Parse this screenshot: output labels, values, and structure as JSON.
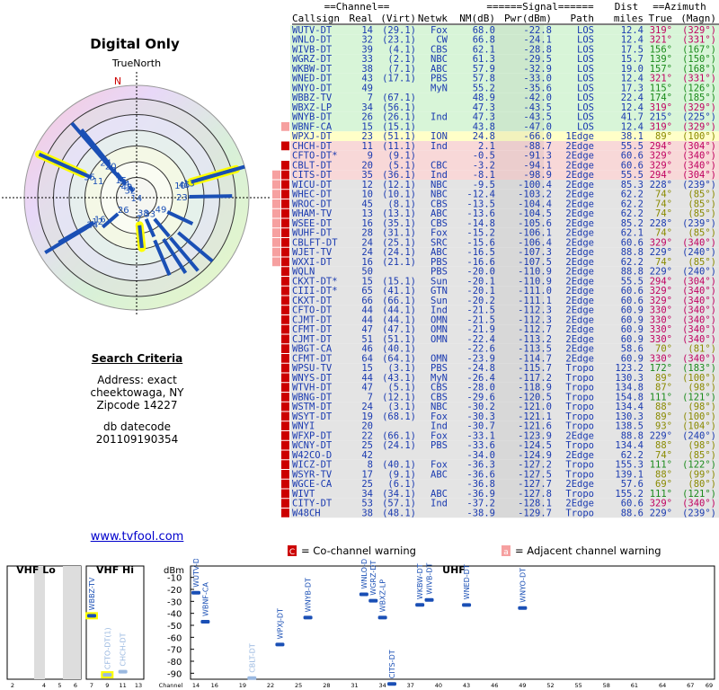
{
  "title": "Digital Only",
  "polar": {
    "north_label": "TrueNorth",
    "n_letter": "N",
    "stations": [
      {
        "label": "24",
        "az": 319,
        "len": 0.88,
        "color": "#1a4fb5",
        "hl": false
      },
      {
        "label": "20",
        "az": 321,
        "len": 0.78,
        "color": "#1a4fb5",
        "hl": false
      },
      {
        "label": "9",
        "az": 321,
        "len": 0.7,
        "color": "#1a4fb5",
        "hl": false
      },
      {
        "label": "15",
        "az": 319,
        "len": 0.5,
        "color": "#1a4fb5",
        "hl": false
      },
      {
        "label": "34",
        "az": 319,
        "len": 0.42,
        "color": "#1a4fb5",
        "hl": false
      },
      {
        "label": "43",
        "az": 319,
        "len": 0.36,
        "color": "#1a4fb5",
        "hl": false
      },
      {
        "label": "32",
        "az": 321,
        "len": 0.28,
        "color": "#1a4fb5",
        "hl": false
      },
      {
        "label": "14",
        "az": 329,
        "len": 0.12,
        "color": "#1a4fb5",
        "hl": false
      },
      {
        "label": "35",
        "az": 294,
        "len": 0.95,
        "color": "#1a4fb5",
        "hl": true
      },
      {
        "label": "11",
        "az": 294,
        "len": 0.8,
        "color": "#1a4fb5",
        "hl": false
      },
      {
        "label": "10",
        "az": 74,
        "len": 0.85,
        "color": "#1a4fb5",
        "hl": false
      },
      {
        "label": "45",
        "az": 74,
        "len": 0.92,
        "color": "#1a4fb5",
        "hl": true
      },
      {
        "label": "13",
        "az": 74,
        "len": 1.0,
        "color": "#1a4fb5",
        "hl": false
      },
      {
        "label": "23",
        "az": 89,
        "len": 0.85,
        "color": "#1a4fb5",
        "hl": false
      },
      {
        "label": "49",
        "az": 115,
        "len": 0.55,
        "color": "#1a4fb5",
        "hl": false
      },
      {
        "label": "33",
        "az": 140,
        "len": 0.45,
        "color": "#1a4fb5",
        "hl": false
      },
      {
        "label": "7",
        "az": 174,
        "len": 0.45,
        "color": "#1a4fb5",
        "hl": true
      },
      {
        "label": "38",
        "az": 156,
        "len": 0.38,
        "color": "#1a4fb5",
        "hl": false
      },
      {
        "label": "26",
        "az": 229,
        "len": 0.4,
        "color": "#1a4fb5",
        "hl": false
      },
      {
        "label": "16",
        "az": 240,
        "len": 0.8,
        "color": "#1a4fb5",
        "hl": false
      },
      {
        "label": "12",
        "az": 239,
        "len": 0.85,
        "color": "#1a4fb5",
        "hl": false
      },
      {
        "label": "24",
        "az": 239,
        "len": 0.95,
        "color": "#1a4fb5",
        "hl": false
      },
      {
        "label": "",
        "az": 147,
        "len": 0.8,
        "color": "#1a4fb5",
        "hl": false
      },
      {
        "label": "",
        "az": 140,
        "len": 0.85,
        "color": "#1a4fb5",
        "hl": false
      },
      {
        "label": "",
        "az": 130,
        "len": 0.88,
        "color": "#1a4fb5",
        "hl": false
      },
      {
        "label": "",
        "az": 157,
        "len": 0.75,
        "color": "#1a4fb5",
        "hl": false
      }
    ]
  },
  "criteria": {
    "heading": "Search Criteria",
    "address": "Address: exact",
    "city": "cheektowaga, NY",
    "zip": "Zipcode 14227",
    "db_label": "db datecode",
    "db_code": "201109190354"
  },
  "site_link": "www.tvfool.com",
  "table": {
    "group_headers": {
      "channel": "Channel",
      "signal": "Signal",
      "dist": "Dist",
      "azimuth": "Azimuth"
    },
    "col_headers": [
      "Callsign",
      "Real",
      "(Virt)",
      "Netwk",
      "NM(dB)",
      "Pwr(dBm)",
      "Path",
      "miles",
      "True",
      "(Magn)"
    ],
    "rows": [
      [
        "WUTV-DT",
        "14",
        "(29.1)",
        "Fox",
        "68.0",
        "-22.8",
        "LOS",
        "12.4",
        "319°",
        "(329°)",
        "g",
        ""
      ],
      [
        "WNLO-DT",
        "32",
        "(23.1)",
        "CW",
        "66.8",
        "-24.1",
        "LOS",
        "12.4",
        "321°",
        "(331°)",
        "g",
        ""
      ],
      [
        "WIVB-DT",
        "39",
        "(4.1)",
        "CBS",
        "62.1",
        "-28.8",
        "LOS",
        "17.5",
        "156°",
        "(167°)",
        "g",
        ""
      ],
      [
        "WGRZ-DT",
        "33",
        "(2.1)",
        "NBC",
        "61.3",
        "-29.5",
        "LOS",
        "15.7",
        "139°",
        "(150°)",
        "g",
        ""
      ],
      [
        "WKBW-DT",
        "38",
        "(7.1)",
        "ABC",
        "57.9",
        "-32.9",
        "LOS",
        "19.0",
        "157°",
        "(168°)",
        "g",
        ""
      ],
      [
        "WNED-DT",
        "43",
        "(17.1)",
        "PBS",
        "57.8",
        "-33.0",
        "LOS",
        "12.4",
        "321°",
        "(331°)",
        "g",
        ""
      ],
      [
        "WNYO-DT",
        "49",
        "",
        "MyN",
        "55.2",
        "-35.6",
        "LOS",
        "17.3",
        "115°",
        "(126°)",
        "g",
        ""
      ],
      [
        "WBBZ-TV",
        "7",
        "(67.1)",
        "",
        "48.9",
        "-42.0",
        "LOS",
        "22.4",
        "174°",
        "(185°)",
        "b",
        ""
      ],
      [
        "WBXZ-LP",
        "34",
        "(56.1)",
        "",
        "47.3",
        "-43.5",
        "LOS",
        "12.4",
        "319°",
        "(329°)",
        "b",
        ""
      ],
      [
        "WNYB-DT",
        "26",
        "(26.1)",
        "Ind",
        "47.3",
        "-43.5",
        "LOS",
        "41.7",
        "215°",
        "(225°)",
        "b",
        ""
      ],
      [
        "WBNF-CA",
        "15",
        "(15.1)",
        "",
        "43.8",
        "-47.0",
        "LOS",
        "12.4",
        "319°",
        "(329°)",
        "b",
        "a"
      ],
      [
        "WPXJ-DT",
        "23",
        "(51.1)",
        "ION",
        "24.8",
        "-66.0",
        "1Edge",
        "38.1",
        "89°",
        "(100°)",
        "y",
        ""
      ],
      [
        "CHCH-DT",
        "11",
        "(11.1)",
        "Ind",
        "2.1",
        "-88.7",
        "2Edge",
        "55.5",
        "294°",
        "(304°)",
        "p",
        "c"
      ],
      [
        "CFTO-DT*",
        "9",
        "(9.1)",
        "",
        "-0.5",
        "-91.3",
        "2Edge",
        "60.6",
        "329°",
        "(340°)",
        "p",
        ""
      ],
      [
        "CBLT-DT",
        "20",
        "(5.1)",
        "CBC",
        "-3.2",
        "-94.1",
        "2Edge",
        "60.6",
        "329°",
        "(340°)",
        "p",
        "c"
      ],
      [
        "CITS-DT",
        "35",
        "(36.1)",
        "Ind",
        "-8.1",
        "-98.9",
        "2Edge",
        "55.5",
        "294°",
        "(304°)",
        "p",
        "ca"
      ],
      [
        "WICU-DT",
        "12",
        "(12.1)",
        "NBC",
        "-9.5",
        "-100.4",
        "2Edge",
        "85.3",
        "228°",
        "(239°)",
        "w",
        "ca"
      ],
      [
        "WHEC-DT",
        "10",
        "(10.1)",
        "NBC",
        "-12.4",
        "-103.2",
        "2Edge",
        "62.2",
        "74°",
        "(85°)",
        "w",
        "ca"
      ],
      [
        "WROC-DT",
        "45",
        "(8.1)",
        "CBS",
        "-13.5",
        "-104.4",
        "2Edge",
        "62.2",
        "74°",
        "(85°)",
        "w",
        "ca"
      ],
      [
        "WHAM-TV",
        "13",
        "(13.1)",
        "ABC",
        "-13.6",
        "-104.5",
        "2Edge",
        "62.2",
        "74°",
        "(85°)",
        "w",
        "ca"
      ],
      [
        "WSEE-DT",
        "16",
        "(35.1)",
        "CBS",
        "-14.8",
        "-105.6",
        "2Edge",
        "85.2",
        "228°",
        "(239°)",
        "w",
        "ca"
      ],
      [
        "WUHF-DT",
        "28",
        "(31.1)",
        "Fox",
        "-15.2",
        "-106.1",
        "2Edge",
        "62.1",
        "74°",
        "(85°)",
        "w",
        "ca"
      ],
      [
        "CBLFT-DT",
        "24",
        "(25.1)",
        "SRC",
        "-15.6",
        "-106.4",
        "2Edge",
        "60.6",
        "329°",
        "(340°)",
        "w",
        "ca"
      ],
      [
        "WJET-TV",
        "24",
        "(24.1)",
        "ABC",
        "-16.5",
        "-107.3",
        "2Edge",
        "88.8",
        "229°",
        "(240°)",
        "w",
        "ca"
      ],
      [
        "WXXI-DT",
        "16",
        "(21.1)",
        "PBS",
        "-16.6",
        "-107.5",
        "2Edge",
        "62.2",
        "74°",
        "(85°)",
        "w",
        "ca"
      ],
      [
        "WQLN",
        "50",
        "",
        "PBS",
        "-20.0",
        "-110.9",
        "2Edge",
        "88.8",
        "229°",
        "(240°)",
        "w",
        "c"
      ],
      [
        "CKXT-DT*",
        "15",
        "(15.1)",
        "Sun",
        "-20.1",
        "-110.9",
        "2Edge",
        "55.5",
        "294°",
        "(304°)",
        "w",
        "c"
      ],
      [
        "CIII-DT*",
        "65",
        "(41.1)",
        "GTN",
        "-20.1",
        "-111.0",
        "2Edge",
        "60.6",
        "329°",
        "(340°)",
        "w",
        "c"
      ],
      [
        "CKXT-DT",
        "66",
        "(66.1)",
        "Sun",
        "-20.2",
        "-111.1",
        "2Edge",
        "60.6",
        "329°",
        "(340°)",
        "w",
        "c"
      ],
      [
        "CFTO-DT",
        "44",
        "(44.1)",
        "Ind",
        "-21.5",
        "-112.3",
        "2Edge",
        "60.9",
        "330°",
        "(340°)",
        "w",
        "c"
      ],
      [
        "CJMT-DT",
        "44",
        "(44.1)",
        "OMN",
        "-21.5",
        "-112.3",
        "2Edge",
        "60.9",
        "330°",
        "(340°)",
        "w",
        "c"
      ],
      [
        "CFMT-DT",
        "47",
        "(47.1)",
        "OMN",
        "-21.9",
        "-112.7",
        "2Edge",
        "60.9",
        "330°",
        "(340°)",
        "w",
        "c"
      ],
      [
        "CJMT-DT",
        "51",
        "(51.1)",
        "OMN",
        "-22.4",
        "-113.2",
        "2Edge",
        "60.9",
        "330°",
        "(340°)",
        "w",
        "c"
      ],
      [
        "WBGT-CA",
        "46",
        "(40.1)",
        "",
        "-22.6",
        "-113.5",
        "2Edge",
        "58.6",
        "70°",
        "(81°)",
        "w",
        "c"
      ],
      [
        "CFMT-DT",
        "64",
        "(64.1)",
        "OMN",
        "-23.9",
        "-114.7",
        "2Edge",
        "60.9",
        "330°",
        "(340°)",
        "w",
        "c"
      ],
      [
        "WPSU-TV",
        "15",
        "(3.1)",
        "PBS",
        "-24.8",
        "-115.7",
        "Tropo",
        "123.2",
        "172°",
        "(183°)",
        "w",
        "c"
      ],
      [
        "WNYS-DT",
        "44",
        "(43.1)",
        "MyN",
        "-26.4",
        "-117.2",
        "Tropo",
        "130.3",
        "89°",
        "(100°)",
        "w",
        "c"
      ],
      [
        "WTVH-DT",
        "47",
        "(5.1)",
        "CBS",
        "-28.0",
        "-118.9",
        "Tropo",
        "134.8",
        "87°",
        "(98°)",
        "w",
        "c"
      ],
      [
        "WBNG-DT",
        "7",
        "(12.1)",
        "CBS",
        "-29.6",
        "-120.5",
        "Tropo",
        "154.8",
        "111°",
        "(121°)",
        "w",
        "c"
      ],
      [
        "WSTM-DT",
        "24",
        "(3.1)",
        "NBC",
        "-30.2",
        "-121.0",
        "Tropo",
        "134.4",
        "88°",
        "(98°)",
        "w",
        "c"
      ],
      [
        "WSYT-DT",
        "19",
        "(68.1)",
        "Fox",
        "-30.3",
        "-121.1",
        "Tropo",
        "130.3",
        "89°",
        "(100°)",
        "w",
        "c"
      ],
      [
        "WNYI",
        "20",
        "",
        "Ind",
        "-30.7",
        "-121.6",
        "Tropo",
        "138.5",
        "93°",
        "(104°)",
        "w",
        "c"
      ],
      [
        "WFXP-DT",
        "22",
        "(66.1)",
        "Fox",
        "-33.1",
        "-123.9",
        "2Edge",
        "88.8",
        "229°",
        "(240°)",
        "w",
        "c"
      ],
      [
        "WCNY-DT",
        "25",
        "(24.1)",
        "PBS",
        "-33.6",
        "-124.5",
        "Tropo",
        "134.4",
        "88°",
        "(98°)",
        "w",
        "c"
      ],
      [
        "W42CO-D",
        "42",
        "",
        "",
        "-34.0",
        "-124.9",
        "2Edge",
        "62.2",
        "74°",
        "(85°)",
        "w",
        "c"
      ],
      [
        "WICZ-DT",
        "8",
        "(40.1)",
        "Fox",
        "-36.3",
        "-127.2",
        "Tropo",
        "155.3",
        "111°",
        "(122°)",
        "w",
        "c"
      ],
      [
        "WSYR-TV",
        "17",
        "(9.1)",
        "ABC",
        "-36.6",
        "-127.5",
        "Tropo",
        "139.1",
        "88°",
        "(99°)",
        "w",
        "c"
      ],
      [
        "WGCE-CA",
        "25",
        "(6.1)",
        "",
        "-36.8",
        "-127.7",
        "2Edge",
        "57.6",
        "69°",
        "(80°)",
        "w",
        "c"
      ],
      [
        "WIVT",
        "34",
        "(34.1)",
        "ABC",
        "-36.9",
        "-127.8",
        "Tropo",
        "155.2",
        "111°",
        "(121°)",
        "w",
        "c"
      ],
      [
        "CITY-DT",
        "53",
        "(57.1)",
        "Ind",
        "-37.2",
        "-128.1",
        "2Edge",
        "60.6",
        "329°",
        "(340°)",
        "w",
        "c"
      ],
      [
        "W48CH",
        "38",
        "(48.1)",
        "",
        "-38.9",
        "-129.7",
        "Tropo",
        "88.6",
        "229°",
        "(239°)",
        "w",
        "c"
      ]
    ]
  },
  "legend": {
    "co_mark": "C",
    "co_text": "= Co-channel warning",
    "adj_mark": "a",
    "adj_text": "= Adjacent channel warning"
  },
  "colors": {
    "los": "#d8f5d8",
    "edge1": "#ffffc8",
    "edge2": "#f8d8d8",
    "tropo": "#e4e4e4",
    "warn": "#cc0000",
    "adj": "#f6a0a0",
    "bar": "#1a4fb5",
    "hl": "#ffff00"
  },
  "chart_data": {
    "type": "scatter",
    "ylabel": "dBm",
    "xlabel": "Channel",
    "band_labels": [
      "VHF Lo",
      "VHF Hi",
      "UHF"
    ],
    "yticks": [
      -10,
      -20,
      -30,
      -40,
      -50,
      -60,
      -70,
      -80,
      -90
    ],
    "ylim": [
      -95,
      -5
    ],
    "vhf_lo_ticks": [
      2,
      4,
      5,
      6
    ],
    "vhf_hi_ticks": [
      7,
      9,
      11,
      13
    ],
    "uhf_ticks": [
      14,
      16,
      19,
      22,
      25,
      28,
      31,
      34,
      37,
      40,
      43,
      46,
      49,
      52,
      55,
      58,
      61,
      64,
      67,
      69
    ],
    "stations": [
      {
        "name": "WBBZ-TV",
        "ch": 7,
        "dbm": -42.0,
        "hl": true,
        "light": false
      },
      {
        "name": "CFTO-DT(1)",
        "ch": 9,
        "dbm": -91.3,
        "hl": true,
        "light": true
      },
      {
        "name": "CHCH-DT",
        "ch": 11,
        "dbm": -88.7,
        "hl": false,
        "light": true
      },
      {
        "name": "WUTV-DT",
        "ch": 14,
        "dbm": -22.8,
        "hl": false,
        "light": false
      },
      {
        "name": "WBNF-CA",
        "ch": 15,
        "dbm": -47.0,
        "hl": false,
        "light": false
      },
      {
        "name": "CBLT-DT",
        "ch": 20,
        "dbm": -94.1,
        "hl": false,
        "light": true
      },
      {
        "name": "WPXJ-DT",
        "ch": 23,
        "dbm": -66.0,
        "hl": false,
        "light": false
      },
      {
        "name": "WNYB-DT",
        "ch": 26,
        "dbm": -43.5,
        "hl": false,
        "light": false
      },
      {
        "name": "WNLO-DT",
        "ch": 32,
        "dbm": -24.1,
        "hl": false,
        "light": false
      },
      {
        "name": "WGRZ-DT",
        "ch": 33,
        "dbm": -29.5,
        "hl": false,
        "light": false
      },
      {
        "name": "WBXZ-LP",
        "ch": 34,
        "dbm": -43.5,
        "hl": false,
        "light": false
      },
      {
        "name": "CITS-DT",
        "ch": 35,
        "dbm": -98.9,
        "hl": false,
        "light": false
      },
      {
        "name": "WKBW-DT",
        "ch": 38,
        "dbm": -32.9,
        "hl": false,
        "light": false
      },
      {
        "name": "WIVB-DT",
        "ch": 39,
        "dbm": -28.8,
        "hl": false,
        "light": false
      },
      {
        "name": "WNED-DT",
        "ch": 43,
        "dbm": -33.0,
        "hl": false,
        "light": false
      },
      {
        "name": "WNYO-DT",
        "ch": 49,
        "dbm": -35.6,
        "hl": false,
        "light": false
      }
    ]
  }
}
